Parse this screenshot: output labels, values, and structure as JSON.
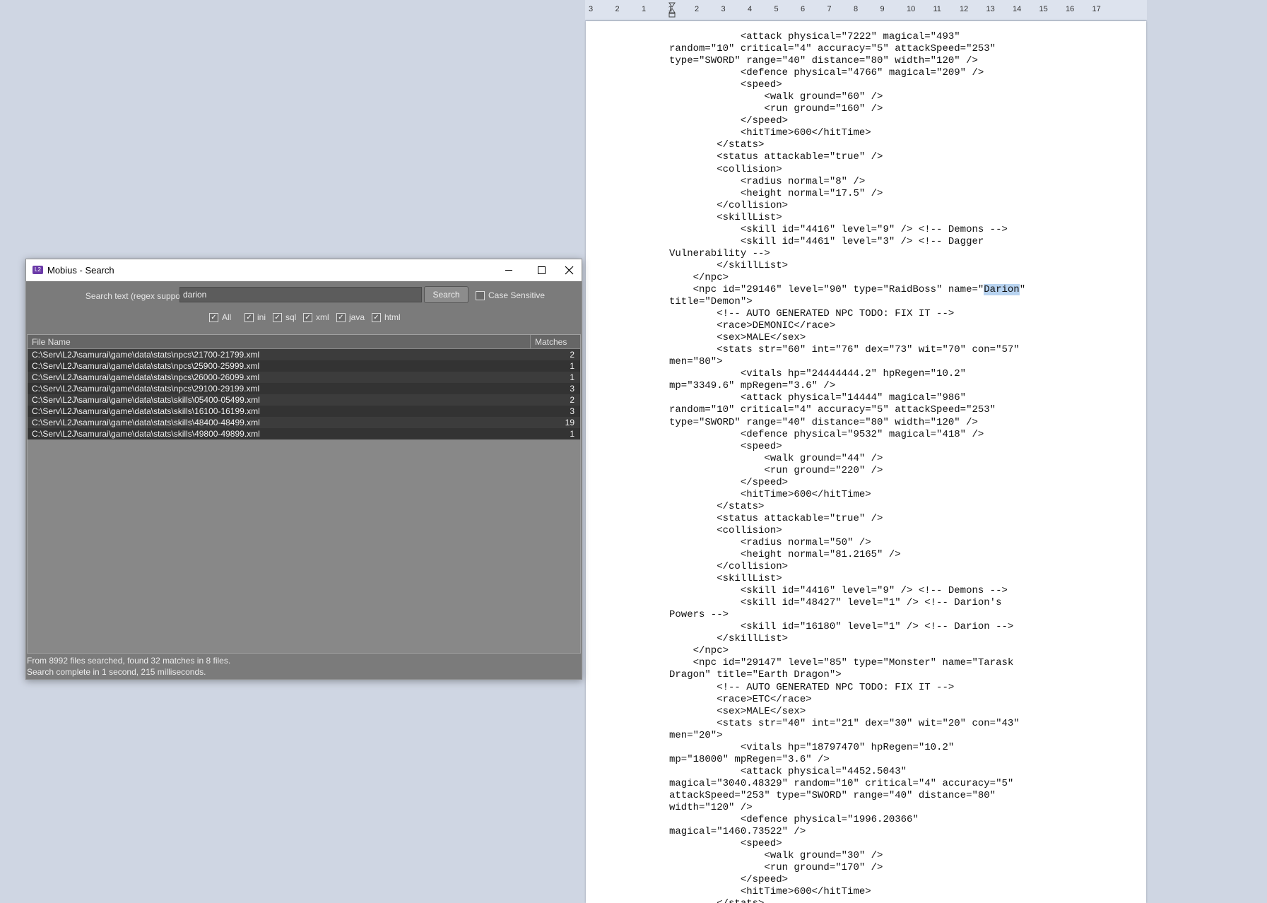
{
  "document": {
    "ruler_ticks": [
      "3",
      "2",
      "1",
      "1",
      "2",
      "3",
      "4",
      "5",
      "6",
      "7",
      "8",
      "9",
      "10",
      "11",
      "12",
      "13",
      "14",
      "15",
      "16",
      "17"
    ],
    "code_before": "            <attack physical=\"7222\" magical=\"493\"\nrandom=\"10\" critical=\"4\" accuracy=\"5\" attackSpeed=\"253\"\ntype=\"SWORD\" range=\"40\" distance=\"80\" width=\"120\" />\n            <defence physical=\"4766\" magical=\"209\" />\n            <speed>\n                <walk ground=\"60\" />\n                <run ground=\"160\" />\n            </speed>\n            <hitTime>600</hitTime>\n        </stats>\n        <status attackable=\"true\" />\n        <collision>\n            <radius normal=\"8\" />\n            <height normal=\"17.5\" />\n        </collision>\n        <skillList>\n            <skill id=\"4416\" level=\"9\" /> <!-- Demons -->\n            <skill id=\"4461\" level=\"3\" /> <!-- Dagger\nVulnerability -->\n        </skillList>\n    </npc>\n    <npc id=\"29146\" level=\"90\" type=\"RaidBoss\" name=\"",
    "code_highlight": "Darion",
    "code_after": "\"\ntitle=\"Demon\">\n        <!-- AUTO GENERATED NPC TODO: FIX IT -->\n        <race>DEMONIC</race>\n        <sex>MALE</sex>\n        <stats str=\"60\" int=\"76\" dex=\"73\" wit=\"70\" con=\"57\"\nmen=\"80\">\n            <vitals hp=\"24444444.2\" hpRegen=\"10.2\"\nmp=\"3349.6\" mpRegen=\"3.6\" />\n            <attack physical=\"14444\" magical=\"986\"\nrandom=\"10\" critical=\"4\" accuracy=\"5\" attackSpeed=\"253\"\ntype=\"SWORD\" range=\"40\" distance=\"80\" width=\"120\" />\n            <defence physical=\"9532\" magical=\"418\" />\n            <speed>\n                <walk ground=\"44\" />\n                <run ground=\"220\" />\n            </speed>\n            <hitTime>600</hitTime>\n        </stats>\n        <status attackable=\"true\" />\n        <collision>\n            <radius normal=\"50\" />\n            <height normal=\"81.2165\" />\n        </collision>\n        <skillList>\n            <skill id=\"4416\" level=\"9\" /> <!-- Demons -->\n            <skill id=\"48427\" level=\"1\" /> <!-- Darion's\nPowers -->\n            <skill id=\"16180\" level=\"1\" /> <!-- Darion -->\n        </skillList>\n    </npc>\n    <npc id=\"29147\" level=\"85\" type=\"Monster\" name=\"Tarask\nDragon\" title=\"Earth Dragon\">\n        <!-- AUTO GENERATED NPC TODO: FIX IT -->\n        <race>ETC</race>\n        <sex>MALE</sex>\n        <stats str=\"40\" int=\"21\" dex=\"30\" wit=\"20\" con=\"43\"\nmen=\"20\">\n            <vitals hp=\"18797470\" hpRegen=\"10.2\"\nmp=\"18000\" mpRegen=\"3.6\" />\n            <attack physical=\"4452.5043\"\nmagical=\"3040.48329\" random=\"10\" critical=\"4\" accuracy=\"5\"\nattackSpeed=\"253\" type=\"SWORD\" range=\"40\" distance=\"80\"\nwidth=\"120\" />\n            <defence physical=\"1996.20366\"\nmagical=\"1460.73522\" />\n            <speed>\n                <walk ground=\"30\" />\n                <run ground=\"170\" />\n            </speed>\n            <hitTime>600</hitTime>\n        </stats>"
  },
  "window": {
    "title": "Mobius - Search",
    "icon_text": "L2",
    "search": {
      "label": "Search text (regex supported):",
      "value": "darion",
      "button": "Search",
      "case_sensitive_label": "Case Sensitive",
      "case_sensitive_checked": false
    },
    "filters": [
      {
        "label": "All",
        "checked": true
      },
      {
        "label": "ini",
        "checked": true
      },
      {
        "label": "sql",
        "checked": true
      },
      {
        "label": "xml",
        "checked": true
      },
      {
        "label": "java",
        "checked": true
      },
      {
        "label": "html",
        "checked": true
      }
    ],
    "table": {
      "col_file": "File Name",
      "col_matches": "Matches",
      "rows": [
        {
          "file": "C:\\Serv\\L2J\\samurai\\game\\data\\stats\\npcs\\21700-21799.xml",
          "matches": "2"
        },
        {
          "file": "C:\\Serv\\L2J\\samurai\\game\\data\\stats\\npcs\\25900-25999.xml",
          "matches": "1"
        },
        {
          "file": "C:\\Serv\\L2J\\samurai\\game\\data\\stats\\npcs\\26000-26099.xml",
          "matches": "1"
        },
        {
          "file": "C:\\Serv\\L2J\\samurai\\game\\data\\stats\\npcs\\29100-29199.xml",
          "matches": "3"
        },
        {
          "file": "C:\\Serv\\L2J\\samurai\\game\\data\\stats\\skills\\05400-05499.xml",
          "matches": "2"
        },
        {
          "file": "C:\\Serv\\L2J\\samurai\\game\\data\\stats\\skills\\16100-16199.xml",
          "matches": "3"
        },
        {
          "file": "C:\\Serv\\L2J\\samurai\\game\\data\\stats\\skills\\48400-48499.xml",
          "matches": "19"
        },
        {
          "file": "C:\\Serv\\L2J\\samurai\\game\\data\\stats\\skills\\49800-49899.xml",
          "matches": "1"
        }
      ]
    },
    "status_line1": "From 8992 files searched, found 32 matches in 8 files.",
    "status_line2": "Search complete in 1 second, 215 milliseconds."
  }
}
